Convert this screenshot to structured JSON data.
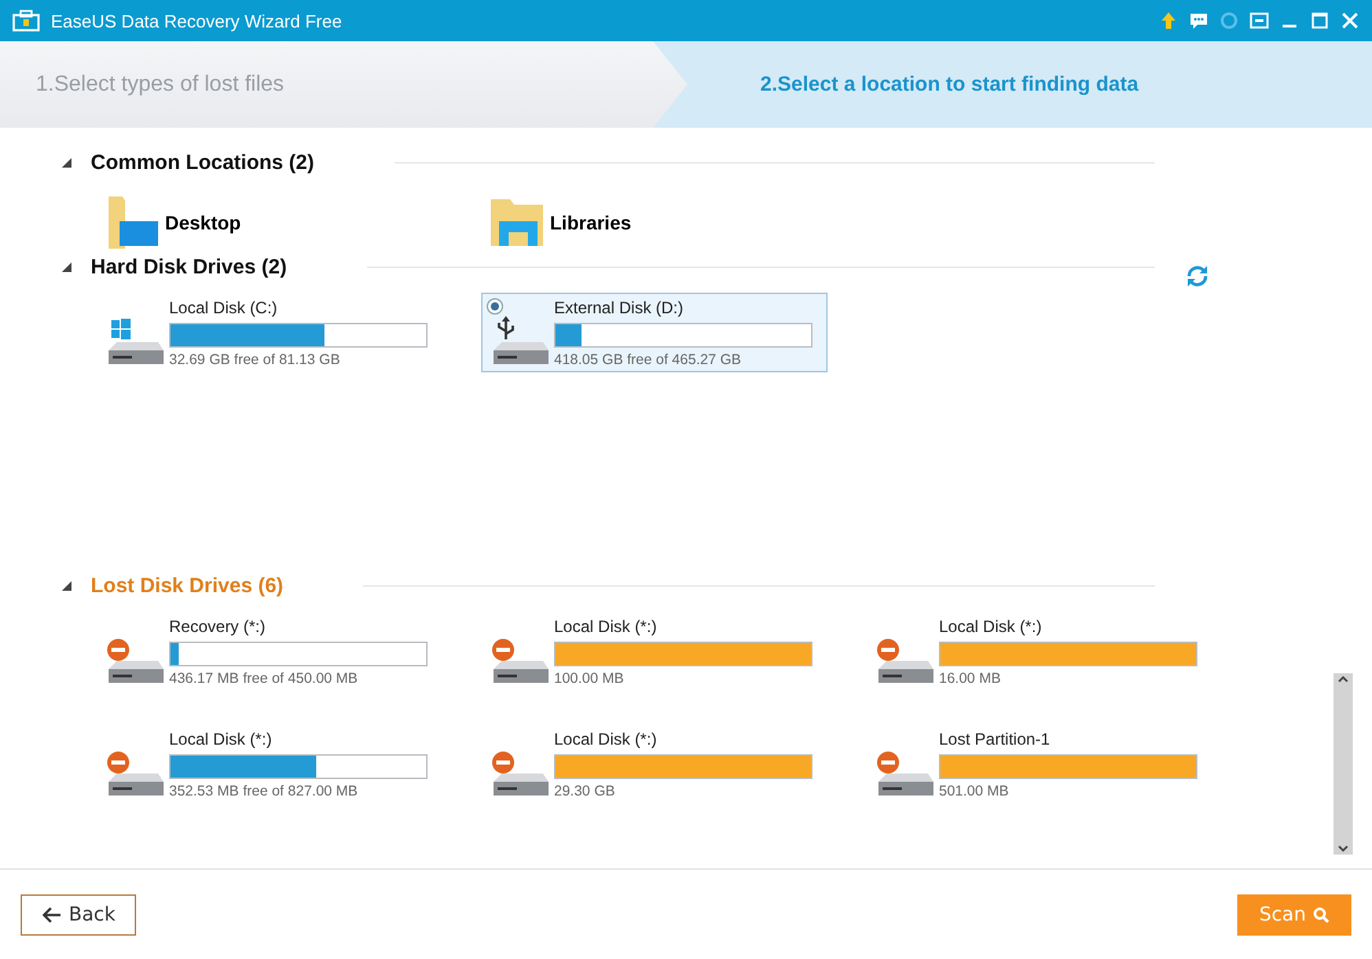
{
  "window": {
    "title": "EaseUS Data Recovery Wizard Free"
  },
  "steps": [
    {
      "label": "1.Select types of lost files",
      "selected": false
    },
    {
      "label": "2.Select a location to start finding data",
      "selected": true
    }
  ],
  "sections": [
    {
      "kind": "locations",
      "title": "Common Locations (2)",
      "expanded": true,
      "color": "#111111",
      "items": [
        {
          "kind": "desktop",
          "name": "Desktop"
        },
        {
          "kind": "libraries",
          "name": "Libraries"
        }
      ]
    },
    {
      "kind": "drives",
      "title": "Hard Disk Drives (2)",
      "expanded": true,
      "color": "#111111",
      "items": [
        {
          "kind": "windows",
          "name": "Local Disk (C:)",
          "level": 0.6,
          "size": "32.69 GB free of 81.13 GB",
          "color": "#259bd6",
          "selected": false
        },
        {
          "kind": "usb",
          "name": "External Disk (D:)",
          "level": 0.1,
          "size": "418.05 GB free of 465.27 GB",
          "color": "#259bd6",
          "selected": true
        }
      ]
    },
    {
      "kind": "lost",
      "title": "Lost Disk Drives (6)",
      "expanded": true,
      "color": "#e0801c",
      "items": [
        {
          "kind": "lost",
          "name": "Recovery (*:)",
          "level": 0.03,
          "size": "436.17 MB free of 450.00 MB",
          "color": "#259bd6",
          "selected": false
        },
        {
          "kind": "lost",
          "name": "Local Disk (*:)",
          "level": 1,
          "size": "100.00 MB",
          "color": "#f8a825",
          "selected": false
        },
        {
          "kind": "lost",
          "name": "Local Disk (*:)",
          "level": 1,
          "size": "16.00 MB",
          "color": "#f8a825",
          "selected": false
        },
        {
          "kind": "lost",
          "name": "Local Disk (*:)",
          "level": 0.57,
          "size": "352.53 MB free of 827.00 MB",
          "color": "#259bd6",
          "selected": false
        },
        {
          "kind": "lost",
          "name": "Local Disk (*:)",
          "level": 1,
          "size": "29.30 GB",
          "color": "#f8a825",
          "selected": false
        },
        {
          "kind": "lost",
          "name": "Lost Partition-1",
          "level": 1,
          "size": "501.00 MB",
          "color": "#f8a825",
          "selected": false
        }
      ]
    }
  ],
  "buttons": {
    "back": "Back",
    "scan": "Scan"
  }
}
